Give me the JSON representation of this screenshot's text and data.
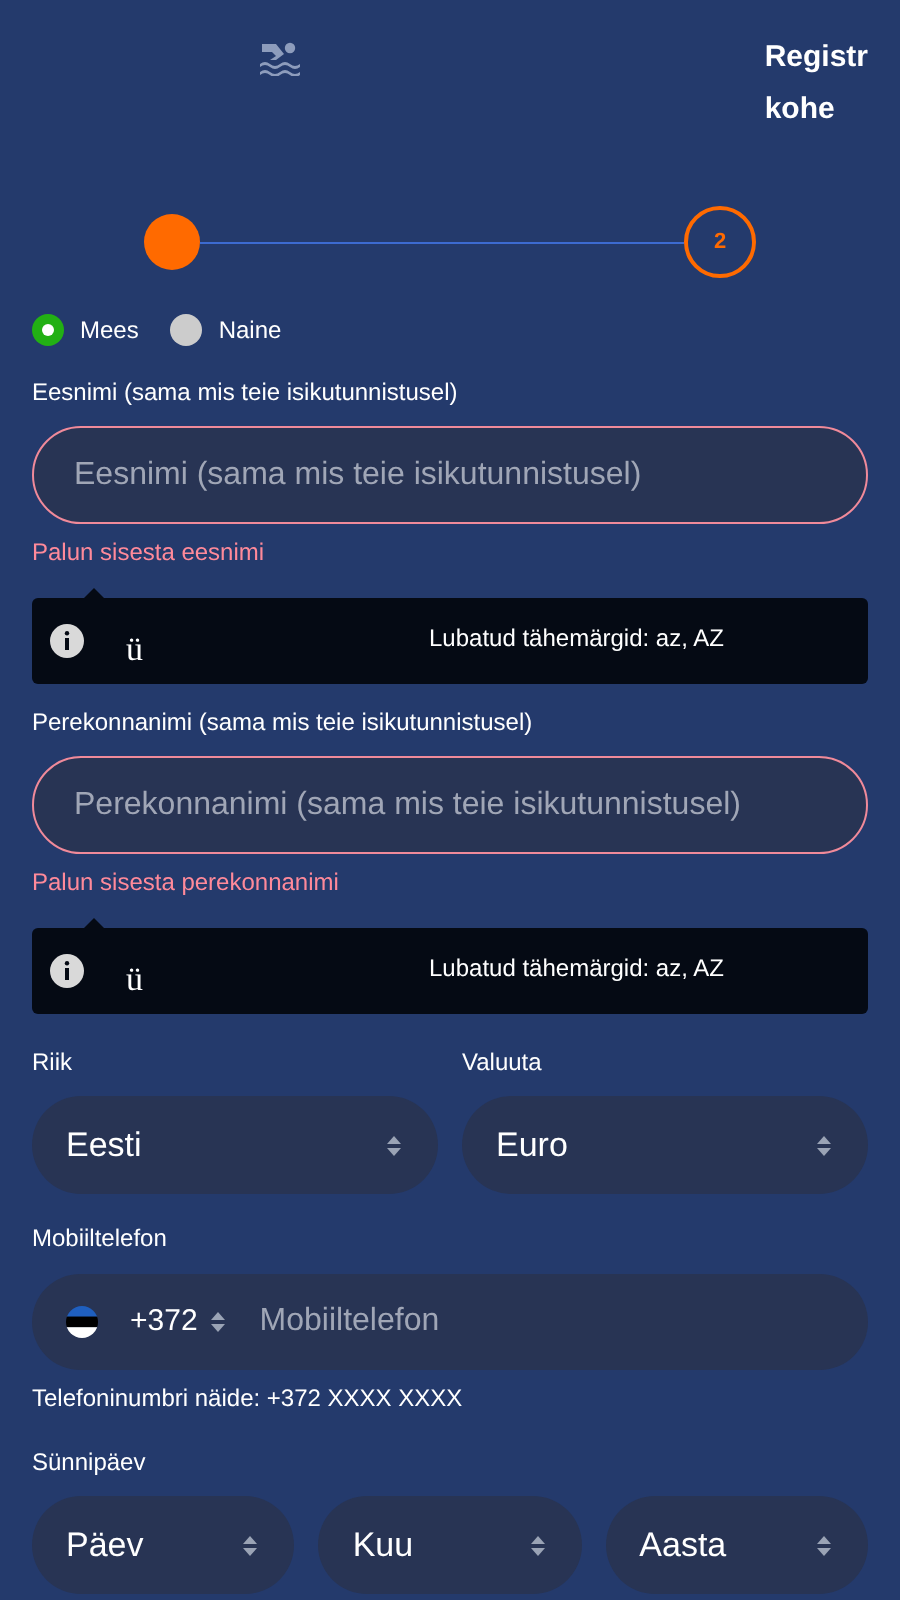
{
  "header": {
    "title_lines": [
      "Registr",
      "kohe"
    ]
  },
  "stepper": [
    {
      "done": true
    },
    {
      "done": false,
      "label": "2"
    }
  ],
  "gender": [
    {
      "label": "Mees",
      "selected": true
    },
    {
      "label": "Naine",
      "selected": false
    }
  ],
  "name_fields": [
    {
      "label": "Eesnimi (sama mis teie isikutunnistusel)",
      "placeholder": "Eesnimi (sama mis teie isikutunnistusel)",
      "invalid": true,
      "error": "Palun sisesta eesnimi",
      "tooltip": {
        "char": "ü",
        "text": "Lubatud tähemärgid: az, AZ"
      }
    },
    {
      "label": "Perekonnanimi (sama mis teie isikutunnistusel)",
      "placeholder": "Perekonnanimi (sama mis teie isikutunnistusel)",
      "invalid": true,
      "error": "Palun sisesta perekonnanimi",
      "tooltip": {
        "char": "ü",
        "text": "Lubatud tähemärgid: az, AZ"
      }
    }
  ],
  "country": {
    "label": "Riik",
    "value": "Eesti"
  },
  "currency": {
    "label": "Valuuta",
    "value": "Euro"
  },
  "phone": {
    "label": "Mobiiltelefon",
    "code": "+372",
    "placeholder": "Mobiiltelefon",
    "hint": "Telefoninumbri näide: +372 XXXX XXXX"
  },
  "birthday": {
    "label": "Sünnipäev",
    "selects": [
      {
        "value": "Päev"
      },
      {
        "value": "Kuu"
      },
      {
        "value": "Aasta"
      }
    ]
  }
}
